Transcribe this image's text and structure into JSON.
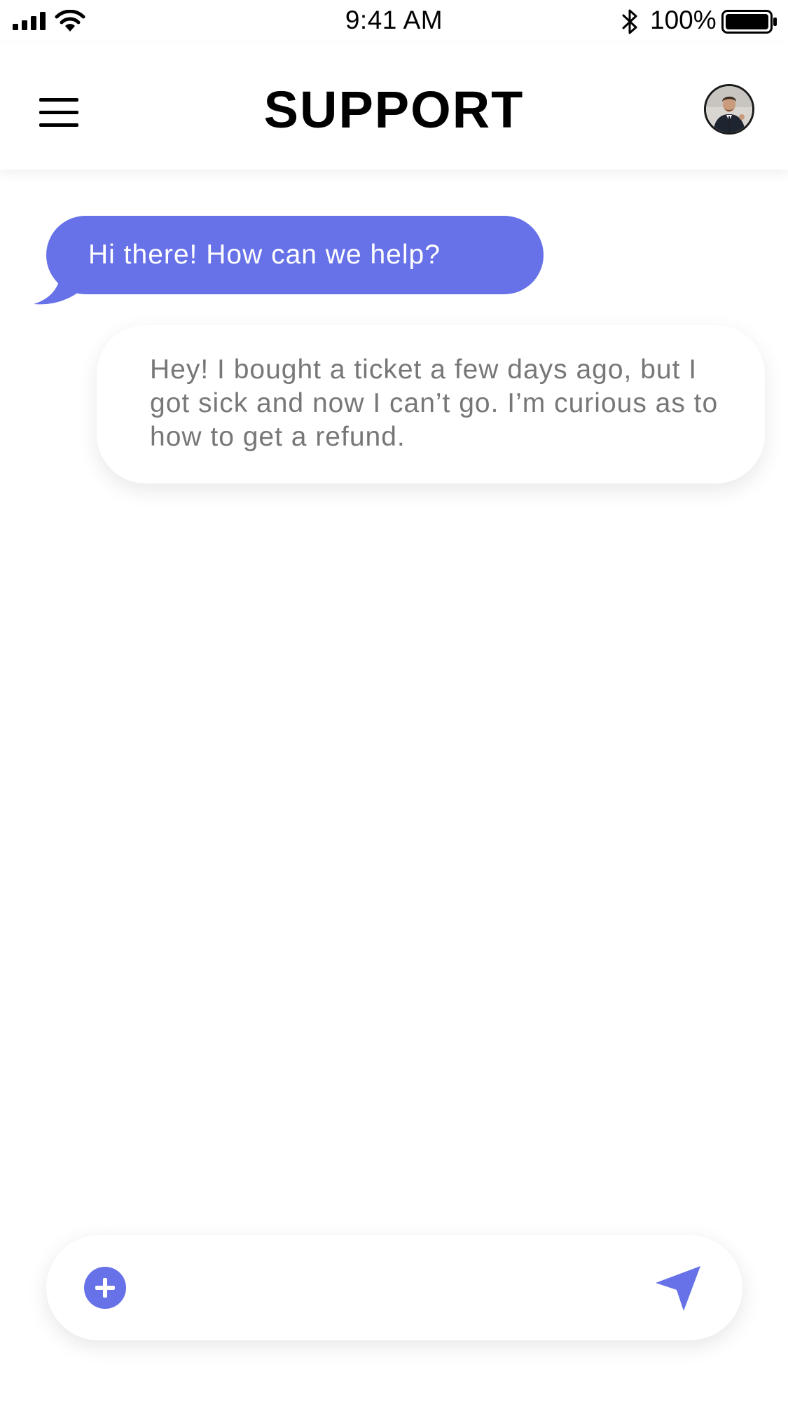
{
  "status_bar": {
    "time": "9:41 AM",
    "battery_percent": "100%",
    "icons": [
      "signal-icon",
      "wifi-icon",
      "bluetooth-icon",
      "battery-icon"
    ]
  },
  "header": {
    "title": "SUPPORT",
    "menu_icon": "hamburger-menu-icon",
    "avatar_icon": "user-avatar"
  },
  "messages": [
    {
      "from": "support",
      "text": "Hi there! How can we help?"
    },
    {
      "from": "user",
      "text": "Hey! I bought a ticket a few days ago, but I got sick and now I can’t go. I’m curious as to how to get a refund."
    }
  ],
  "composer": {
    "value": "",
    "add_icon": "plus-icon",
    "send_icon": "send-icon"
  },
  "colors": {
    "accent": "#6771e8",
    "incoming_bubble_text": "#ffffff",
    "outgoing_bubble_text": "#777777",
    "background": "#ffffff"
  }
}
